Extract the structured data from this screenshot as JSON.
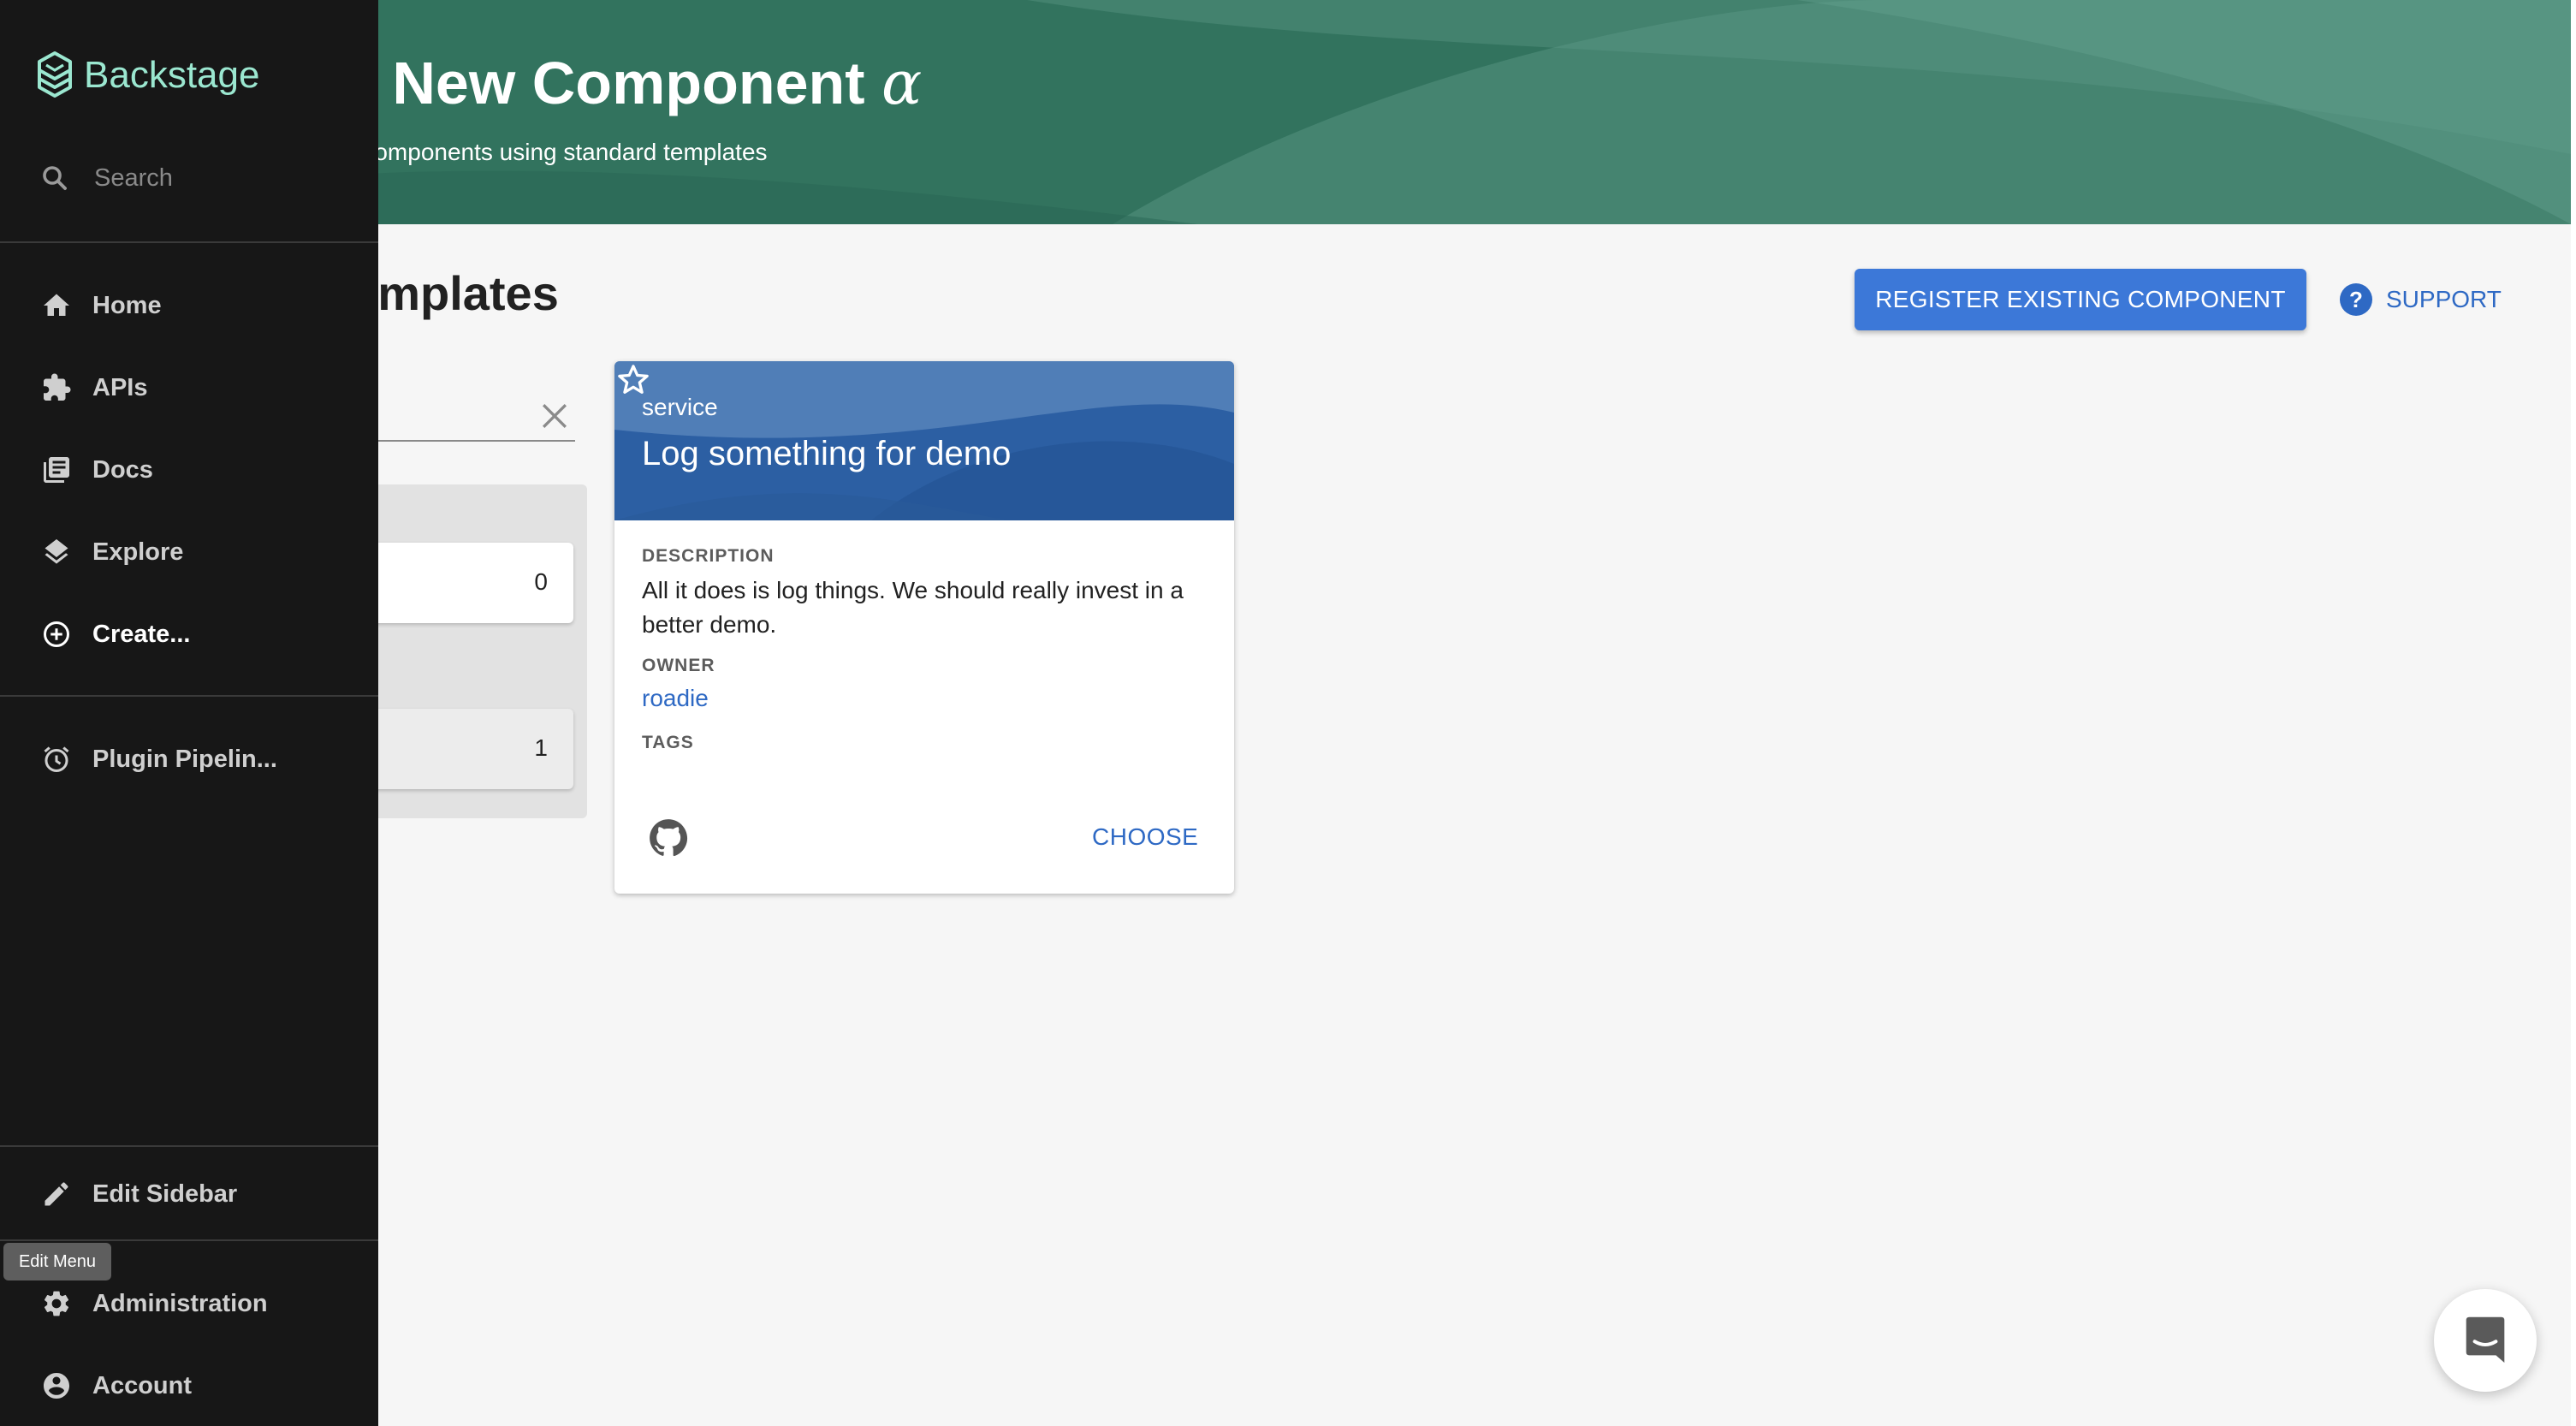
{
  "header": {
    "title": "a New Component",
    "title_symbol": "α",
    "subtitle": "e components using standard templates"
  },
  "content": {
    "title": "Templates",
    "register_button": "REGISTER EXISTING COMPONENT",
    "support_button": "SUPPORT",
    "filters": [
      {
        "count": "0"
      },
      {
        "count": "1"
      }
    ]
  },
  "card": {
    "type": "service",
    "title": "Log something for demo",
    "description_label": "DESCRIPTION",
    "description": "All it does is log things. We should really invest in a better demo.",
    "owner_label": "OWNER",
    "owner": "roadie",
    "tags_label": "TAGS",
    "choose_label": "CHOOSE"
  },
  "sidebar": {
    "logo": "Backstage",
    "search_placeholder": "Search",
    "items": [
      {
        "label": "Home",
        "icon": "home-icon"
      },
      {
        "label": "APIs",
        "icon": "puzzle-icon"
      },
      {
        "label": "Docs",
        "icon": "library-icon"
      },
      {
        "label": "Explore",
        "icon": "layers-icon"
      },
      {
        "label": "Create...",
        "icon": "add-circle-icon"
      }
    ],
    "plugin_item": "Plugin Pipelin...",
    "edit_sidebar": "Edit Sidebar",
    "tooltip": "Edit Menu",
    "administration": "Administration",
    "account": "Account"
  },
  "colors": {
    "header_bg": "#32735e",
    "sidebar_bg": "#171717",
    "primary": "#3c78d8",
    "link": "#2e69c4",
    "logo": "#9be7d0"
  }
}
